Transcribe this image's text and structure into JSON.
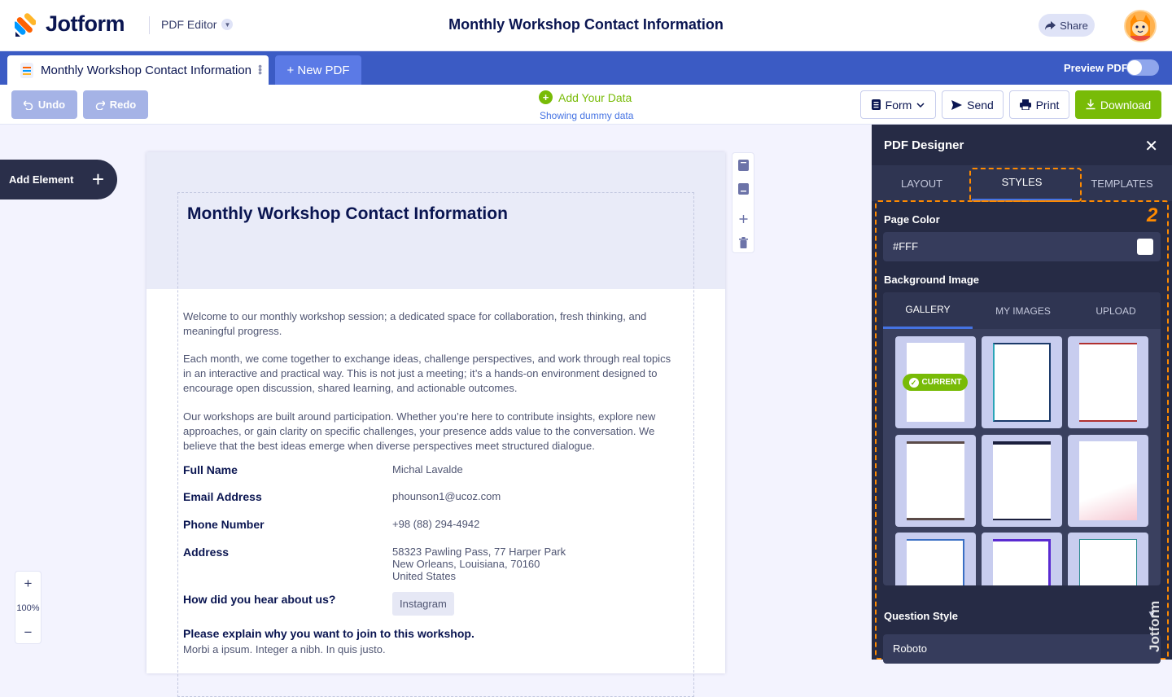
{
  "brand": {
    "name": "Jotform",
    "app": "PDF Editor"
  },
  "header": {
    "title": "Monthly Workshop Contact Information",
    "share_label": "Share"
  },
  "tabs": {
    "active": "Monthly Workshop Contact Information",
    "new_label": "+ New PDF",
    "preview_label": "Preview PDF",
    "preview_on": false
  },
  "toolbar": {
    "undo": "Undo",
    "redo": "Redo",
    "add_data": "Add Your Data",
    "dummy_note": "Showing dummy data",
    "form": "Form",
    "send": "Send",
    "print": "Print",
    "download": "Download"
  },
  "canvas": {
    "add_element": "Add Element",
    "zoom": "100%",
    "zoom_in": "+",
    "zoom_out": "−"
  },
  "document": {
    "title": "Monthly Workshop Contact Information",
    "paragraphs": [
      "Welcome to our monthly workshop session; a dedicated space for collaboration, fresh thinking, and meaningful progress.",
      "Each month, we come together to exchange ideas, challenge perspectives, and work through real topics in an interactive and practical way. This is not just a meeting; it’s a hands-on environment designed to encourage open discussion, shared learning, and actionable outcomes.",
      "Our workshops are built around participation. Whether you’re here to contribute insights, explore new approaches, or gain clarity on specific challenges, your presence adds value to the conversation. We believe that the best ideas emerge when diverse perspectives meet structured dialogue."
    ],
    "fields": [
      {
        "label": "Full Name",
        "value": "Michal Lavalde"
      },
      {
        "label": "Email Address",
        "value": "phounson1@ucoz.com"
      },
      {
        "label": "Phone Number",
        "value": "+98 (88) 294-4942"
      },
      {
        "label": "Address",
        "value_lines": [
          "58323 Pawling Pass, 77 Harper Park",
          "New Orleans, Louisiana, 70160",
          "United States"
        ]
      },
      {
        "label": "How did you hear about us?",
        "value": "Instagram"
      }
    ],
    "question": "Please explain why you want to join to this workshop.",
    "answer": "Morbi a ipsum. Integer a nibh. In quis justo."
  },
  "panel": {
    "title": "PDF Designer",
    "tabs": [
      "LAYOUT",
      "STYLES",
      "TEMPLATES"
    ],
    "active_tab": "STYLES",
    "step_badge": "2",
    "page_color_label": "Page Color",
    "page_color_value": "#FFF",
    "bg_image_label": "Background Image",
    "bg_tabs": [
      "GALLERY",
      "MY IMAGES",
      "UPLOAD"
    ],
    "current_label": "CURRENT",
    "question_style_label": "Question Style",
    "font_value": "Roboto",
    "watermark": "Jotform"
  },
  "colors": {
    "accent_blue": "#3b5bc4",
    "green": "#78bb07",
    "panel_bg": "#262b45",
    "highlight": "#ff8a00"
  }
}
